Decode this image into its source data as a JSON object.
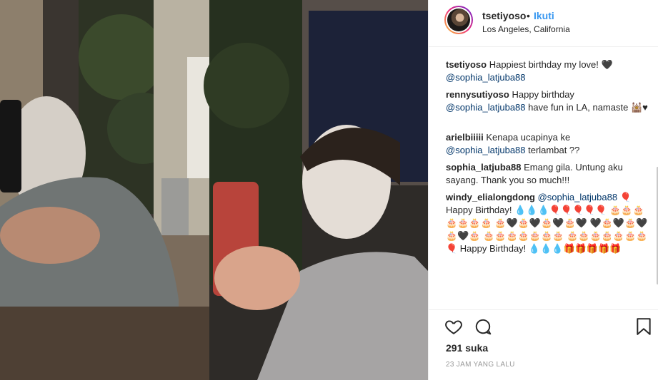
{
  "post": {
    "username": "tsetiyoso",
    "separator": "•",
    "follow_label": "Ikuti",
    "location": "Los Angeles, California"
  },
  "comments": [
    {
      "user": "tsetiyoso",
      "text": "Happiest birthday my love! 🖤",
      "mention": "@sophia_latjuba88",
      "after": ""
    },
    {
      "user": "rennysutiyoso",
      "text": "Happy birthday",
      "mention": "@sophia_latjuba88",
      "after": " have fun in LA, namaste 🕍♥"
    },
    {
      "user": "arielbiiiii",
      "text": "Kenapa ucapinya ke",
      "mention": "@sophia_latjuba88",
      "after": " terlambat ??"
    },
    {
      "user": "sophia_latjuba88",
      "text": "Emang gila. Untung aku sayang. Thank you so much!!!",
      "mention": "",
      "after": ""
    },
    {
      "user": "windy_elialongdong",
      "text": "",
      "mention": "@sophia_latjuba88",
      "after": " 🎈 Happy Birthday! 💧💧💧🎈🎈🎈🎈🎈 🎂🎂🎂🎂🎂🎂🎂 🎂🖤🎂🖤🎂🖤🎂🖤 🖤🎂🖤🎂🖤🎂🖤🎂 🎂🎂🎂🎂🎂🎂🎂 🎂🎂🎂🎂🎂🎂🎂 🎈 Happy Birthday! 💧💧💧🎁🎁🎁🎁🎁"
    }
  ],
  "footer": {
    "likes": "291 suka",
    "time": "23 JAM YANG LALU"
  },
  "icons": [
    "heart-icon",
    "comment-icon",
    "bookmark-icon",
    "avatar"
  ],
  "colors": {
    "link": "#3897f0",
    "mention": "#003569",
    "border": "#efefef",
    "muted": "#999999"
  }
}
